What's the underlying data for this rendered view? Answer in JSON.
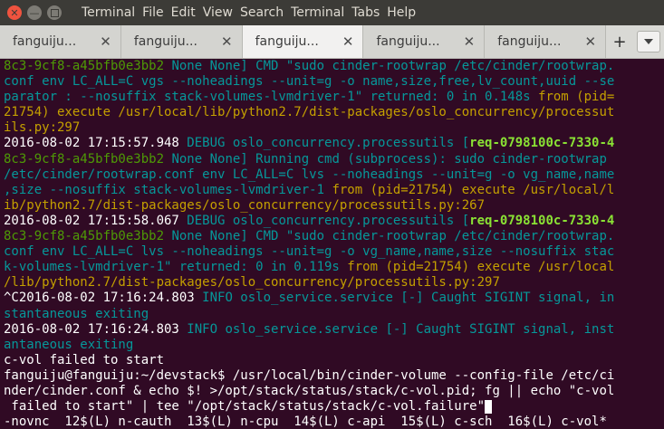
{
  "menubar": {
    "close_glyph": "✕",
    "min_glyph": "—",
    "items": [
      "Terminal",
      "File",
      "Edit",
      "View",
      "Search",
      "Terminal",
      "Tabs",
      "Help"
    ]
  },
  "tabs": [
    {
      "label": "fanguiju...",
      "close": "✕"
    },
    {
      "label": "fanguiju...",
      "close": "✕"
    },
    {
      "label": "fanguiju...",
      "close": "✕"
    },
    {
      "label": "fanguiju...",
      "close": "✕"
    },
    {
      "label": "fanguiju...",
      "close": "✕"
    }
  ],
  "new_tab": "+",
  "lines": [
    [
      {
        "c": "g",
        "t": "8c3-9cf8-a45bfb0e3bb2 "
      },
      {
        "c": "cy",
        "t": "None None] CMD \"sudo cinder-rootwrap /etc/cinder/rootwrap."
      }
    ],
    [
      {
        "c": "cy",
        "t": "conf env LC_ALL=C vgs --noheadings --unit=g -o name,size,free,lv_count,uuid --se"
      }
    ],
    [
      {
        "c": "cy",
        "t": "parator : --nosuffix stack-volumes-lvmdriver-1\" returned: 0 in 0.148s "
      },
      {
        "c": "y",
        "t": "from (pid="
      }
    ],
    [
      {
        "c": "y",
        "t": "21754) execute /usr/local/lib/python2.7/dist-packages/oslo_concurrency/processut"
      }
    ],
    [
      {
        "c": "y",
        "t": "ils.py:297"
      }
    ],
    [
      {
        "c": "w",
        "t": "2016-08-02 17:15:57.948 "
      },
      {
        "c": "cy",
        "t": "DEBUG oslo_concurrency.processutils ["
      },
      {
        "c": "gr",
        "t": "req-0798100c-7330-4"
      }
    ],
    [
      {
        "c": "g",
        "t": "8c3-9cf8-a45bfb0e3bb2 "
      },
      {
        "c": "cy",
        "t": "None None] Running cmd (subprocess): sudo cinder-rootwrap"
      }
    ],
    [
      {
        "c": "cy",
        "t": "/etc/cinder/rootwrap.conf env LC_ALL=C lvs --noheadings --unit=g -o vg_name,name"
      }
    ],
    [
      {
        "c": "cy",
        "t": ",size --nosuffix stack-volumes-lvmdriver-1 "
      },
      {
        "c": "y",
        "t": "from (pid=21754) execute /usr/local/l"
      }
    ],
    [
      {
        "c": "y",
        "t": "ib/python2.7/dist-packages/oslo_concurrency/processutils.py:267"
      }
    ],
    [
      {
        "c": "w",
        "t": "2016-08-02 17:15:58.067 "
      },
      {
        "c": "cy",
        "t": "DEBUG oslo_concurrency.processutils ["
      },
      {
        "c": "gr",
        "t": "req-0798100c-7330-4"
      }
    ],
    [
      {
        "c": "g",
        "t": "8c3-9cf8-a45bfb0e3bb2 "
      },
      {
        "c": "cy",
        "t": "None None] CMD \"sudo cinder-rootwrap /etc/cinder/rootwrap."
      }
    ],
    [
      {
        "c": "cy",
        "t": "conf env LC_ALL=C lvs --noheadings --unit=g -o vg_name,name,size --nosuffix stac"
      }
    ],
    [
      {
        "c": "cy",
        "t": "k-volumes-lvmdriver-1\" returned: 0 in 0.119s "
      },
      {
        "c": "y",
        "t": "from (pid=21754) execute /usr/local"
      }
    ],
    [
      {
        "c": "y",
        "t": "/lib/python2.7/dist-packages/oslo_concurrency/processutils.py:297"
      }
    ],
    [
      {
        "c": "w",
        "t": "^C2016-08-02 17:16:24.803 "
      },
      {
        "c": "cy",
        "t": "INFO oslo_service.service [-] Caught SIGINT signal, in"
      }
    ],
    [
      {
        "c": "cy",
        "t": "stantaneous exiting"
      }
    ],
    [
      {
        "c": "w",
        "t": "2016-08-02 17:16:24.803 "
      },
      {
        "c": "cy",
        "t": "INFO oslo_service.service [-] Caught SIGINT signal, inst"
      }
    ],
    [
      {
        "c": "cy",
        "t": "antaneous exiting"
      }
    ],
    [
      {
        "c": "w",
        "t": "c-vol failed to start"
      }
    ],
    [
      {
        "c": "w",
        "t": "fanguiju@fanguiju:~/devstack$ /usr/local/bin/cinder-volume --config-file /etc/ci"
      }
    ],
    [
      {
        "c": "w",
        "t": "nder/cinder.conf & echo $! >/opt/stack/status/stack/c-vol.pid; fg || echo \"c-vol"
      }
    ],
    [
      {
        "c": "w",
        "t": " failed to start\" | tee \"/opt/stack/status/stack/c-vol.failure\""
      },
      {
        "c": "cursor",
        "t": ""
      }
    ],
    [
      {
        "c": "w",
        "t": "-novnc  12$(L) n-cauth  13$(L) n-cpu  14$(L) c-api  15$(L) c-sch  16$(L) c-vol*"
      }
    ]
  ]
}
